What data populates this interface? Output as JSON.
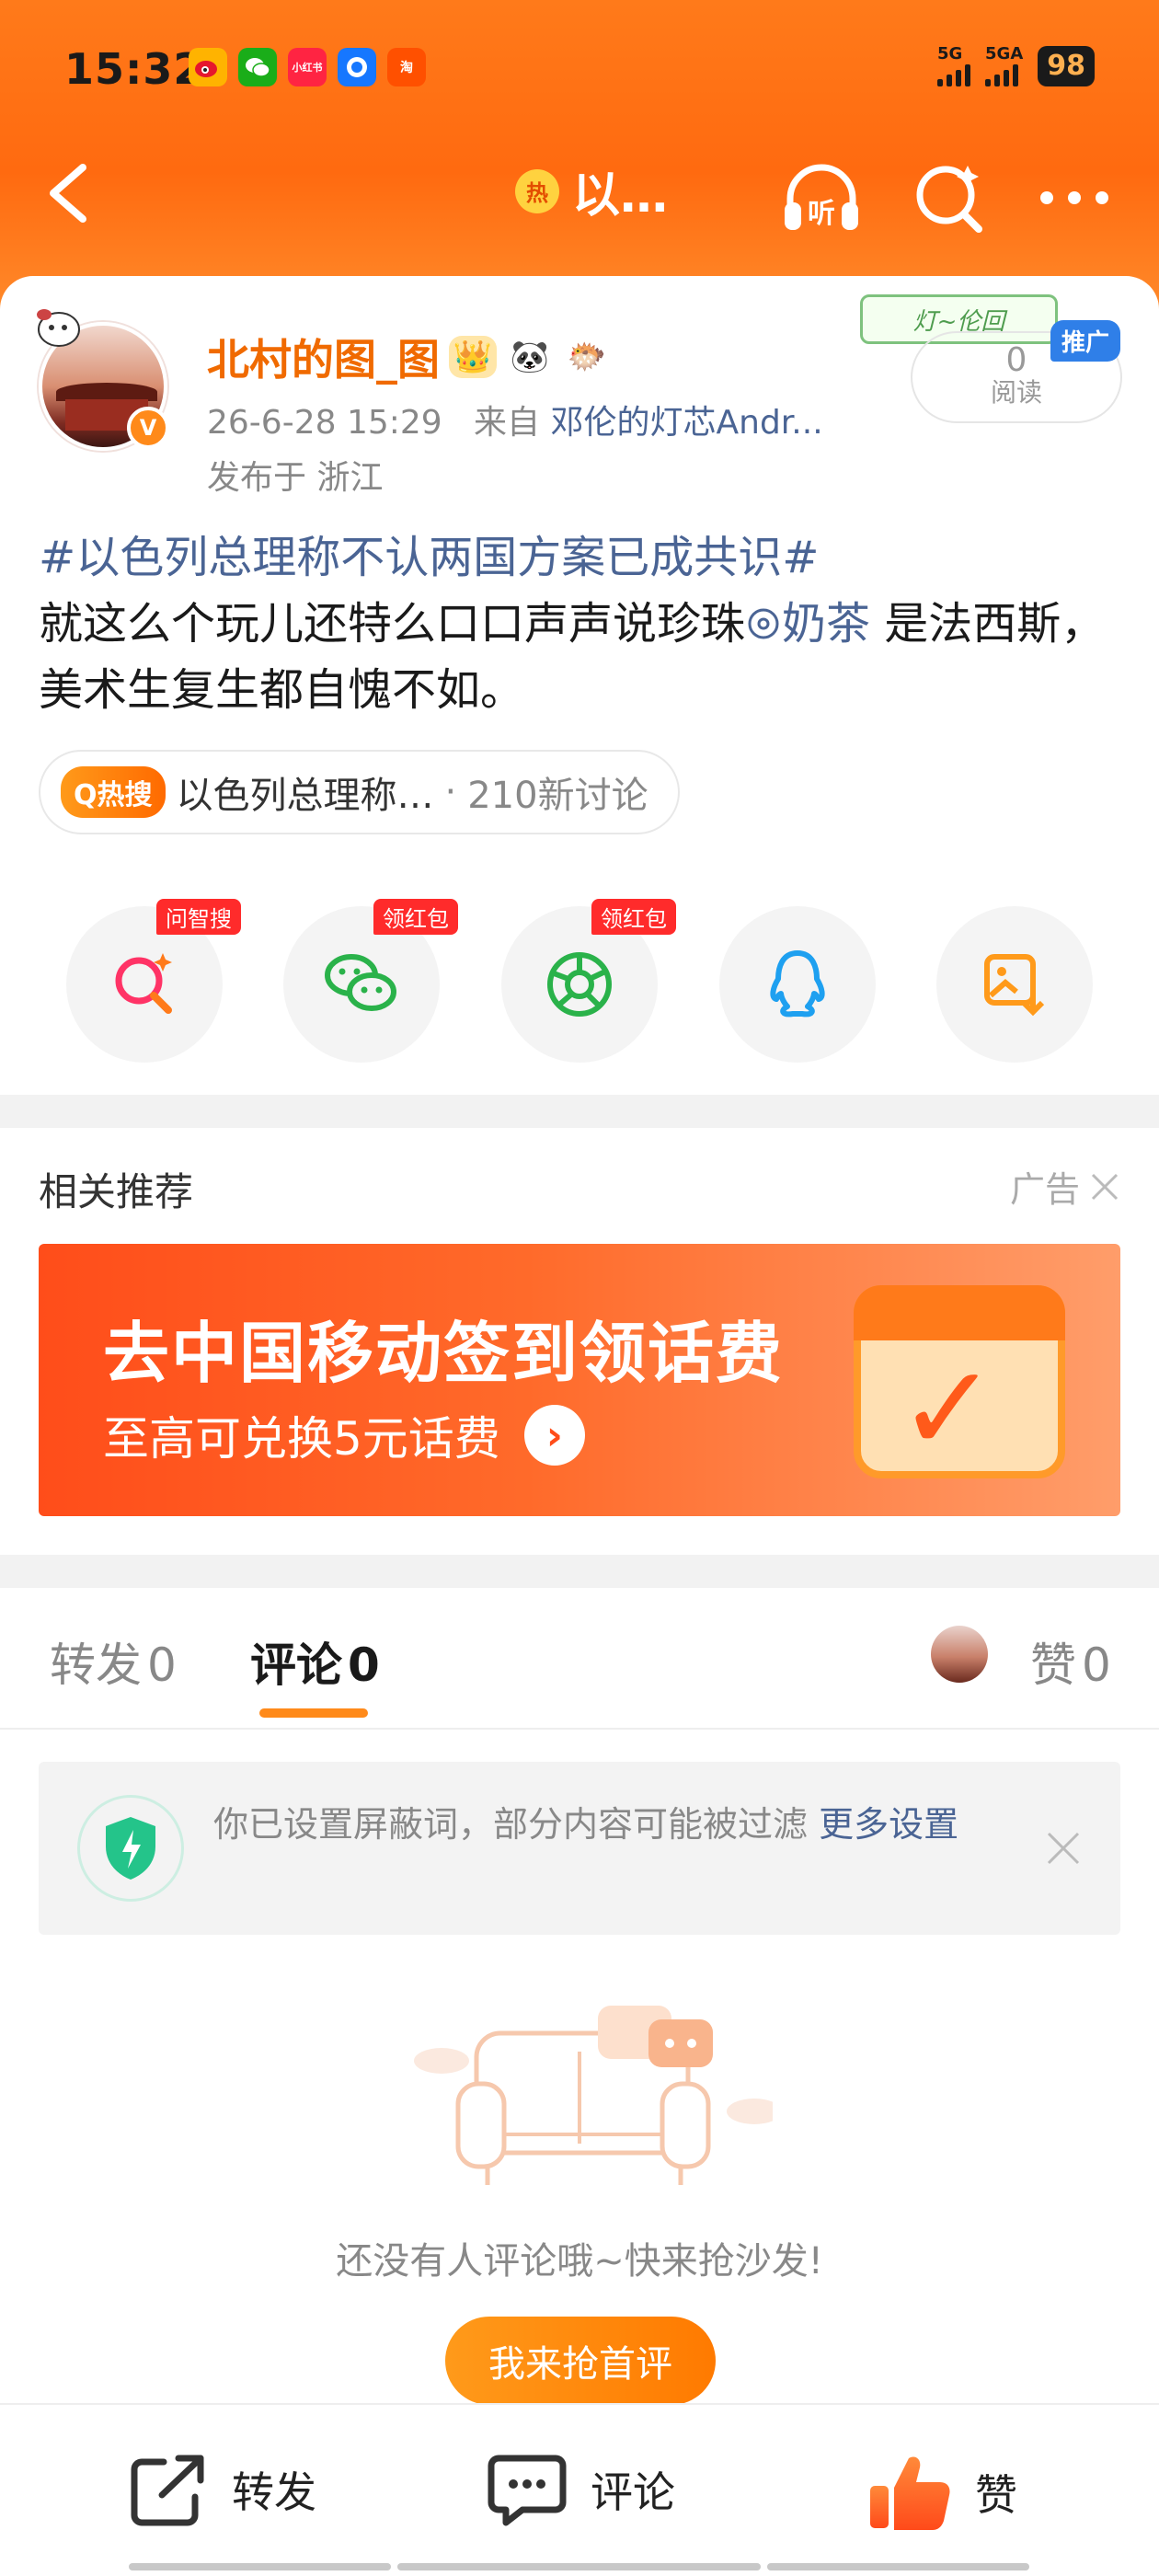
{
  "status_bar": {
    "time": "15:32",
    "apps": [
      {
        "icon": "weibo-icon",
        "color": "#ff6a00",
        "text": ""
      },
      {
        "icon": "wechat-icon",
        "color": "#1aad19",
        "text": ""
      },
      {
        "icon": "xiaohongshu-icon",
        "color": "#ff2442",
        "text": "小红书"
      },
      {
        "icon": "alipay-icon",
        "color": "#1677ff",
        "text": ""
      },
      {
        "icon": "taobao-icon",
        "color": "#ff5000",
        "text": "淘"
      }
    ],
    "signal1_label": "5G",
    "signal2_label": "5GA",
    "battery": "98"
  },
  "nav": {
    "hot_badge": "热",
    "title": "以…"
  },
  "post": {
    "username": "北村的图_图",
    "timestamp": "26-6-28 15:29",
    "source_prefix": "来自",
    "source": "邓伦的灯芯Andr...",
    "location": "发布于 浙江",
    "read_count": "0",
    "read_label": "阅读",
    "promo_tag": "推广",
    "lantern_text": "灯~伦回",
    "hashtag": "#以色列总理称不认两国方案已成共识#",
    "text_1": "就这么个玩儿还特么口口声声说珍珠",
    "mention": "奶茶",
    "text_2": " 是法西斯，美术生复生都自愧不如。",
    "hot_pill": {
      "tag": "Q热搜",
      "topic": "以色列总理称…",
      "sep": "·",
      "discussion": "210新讨论"
    }
  },
  "share": [
    {
      "name": "ask-search-icon",
      "badge": "问智搜"
    },
    {
      "name": "wechat-share-icon",
      "badge": "领红包"
    },
    {
      "name": "moments-share-icon",
      "badge": "领红包"
    },
    {
      "name": "qq-share-icon",
      "badge": ""
    },
    {
      "name": "save-image-icon",
      "badge": ""
    }
  ],
  "related": {
    "title": "相关推荐",
    "ad_label": "广告",
    "banner_title": "去中国移动签到领话费",
    "banner_sub": "至高可兑换5元话费"
  },
  "tabs": {
    "repost": "转发",
    "repost_count": "0",
    "comment": "评论",
    "comment_count": "0",
    "like": "赞",
    "like_count": "0"
  },
  "notice": {
    "text": "你已设置屏蔽词，部分内容可能被过滤 ",
    "link": "更多设置"
  },
  "empty": {
    "text": "还没有人评论哦~快来抢沙发!",
    "button": "我来抢首评"
  },
  "bottom_bar": {
    "repost": "转发",
    "comment": "评论",
    "like": "赞"
  },
  "colors": {
    "accent": "#ff7a1a",
    "link": "#4a6494",
    "username": "#f06a00"
  }
}
